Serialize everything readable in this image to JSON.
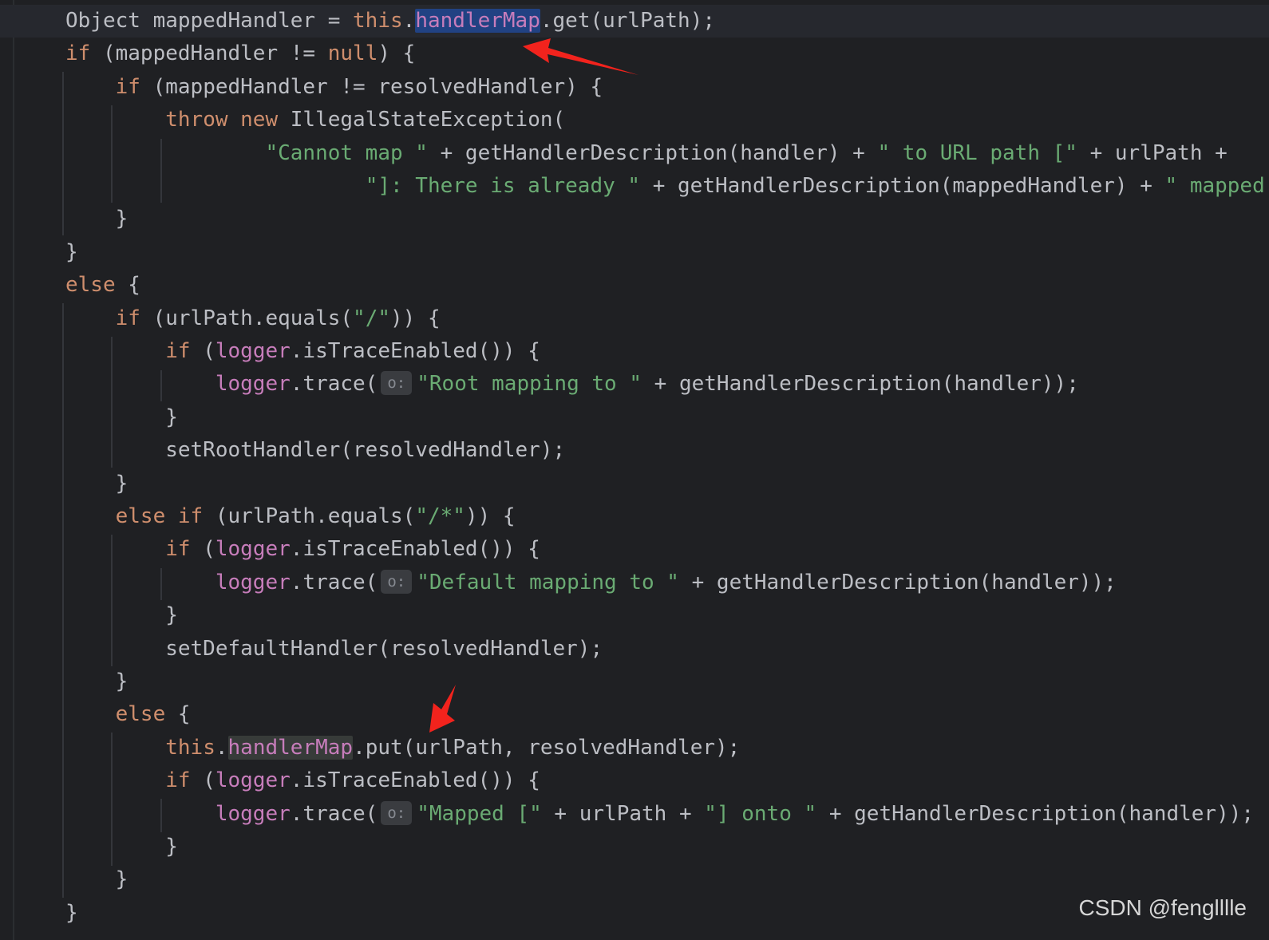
{
  "colors": {
    "background": "#1f2023",
    "default_text": "#bcbec4",
    "keyword": "#cf8e6d",
    "string": "#6aab73",
    "field": "#c77dbb",
    "hint_text": "#868a91",
    "annotation_arrow": "#f2231d"
  },
  "code": {
    "lines": [
      {
        "tokens": [
          {
            "text": "Object mappedHandler = ",
            "c": "d"
          },
          {
            "text": "this",
            "c": "k"
          },
          {
            "text": ".",
            "c": "d"
          },
          {
            "text": "handlerMap",
            "c": "f",
            "hl": "sel"
          },
          {
            "text": ".get(urlPath);",
            "c": "d"
          }
        ]
      },
      {
        "tokens": [
          {
            "text": "if",
            "c": "k"
          },
          {
            "text": " (mappedHandler != ",
            "c": "d"
          },
          {
            "text": "null",
            "c": "k"
          },
          {
            "text": ") {",
            "c": "d"
          }
        ]
      },
      {
        "tokens": [
          {
            "text": "    ",
            "c": "d"
          },
          {
            "text": "if",
            "c": "k"
          },
          {
            "text": " (mappedHandler != resolvedHandler) {",
            "c": "d"
          }
        ]
      },
      {
        "tokens": [
          {
            "text": "        ",
            "c": "d"
          },
          {
            "text": "throw new",
            "c": "k"
          },
          {
            "text": " IllegalStateException(",
            "c": "d"
          }
        ]
      },
      {
        "tokens": [
          {
            "text": "                ",
            "c": "d"
          },
          {
            "text": "\"Cannot map \"",
            "c": "s"
          },
          {
            "text": " + getHandlerDescription(handler) + ",
            "c": "d"
          },
          {
            "text": "\" to URL path [\"",
            "c": "s"
          },
          {
            "text": " + urlPath +",
            "c": "d"
          }
        ]
      },
      {
        "tokens": [
          {
            "text": "                        ",
            "c": "d"
          },
          {
            "text": "\"]: There is already \"",
            "c": "s"
          },
          {
            "text": " + getHandlerDescription(mappedHandler) + ",
            "c": "d"
          },
          {
            "text": "\" mapped.",
            "c": "s"
          }
        ]
      },
      {
        "tokens": [
          {
            "text": "    }",
            "c": "d"
          }
        ]
      },
      {
        "tokens": [
          {
            "text": "}",
            "c": "d"
          }
        ]
      },
      {
        "tokens": [
          {
            "text": "else",
            "c": "k"
          },
          {
            "text": " {",
            "c": "d"
          }
        ]
      },
      {
        "tokens": [
          {
            "text": "    ",
            "c": "d"
          },
          {
            "text": "if",
            "c": "k"
          },
          {
            "text": " (urlPath.equals(",
            "c": "d"
          },
          {
            "text": "\"/\"",
            "c": "s"
          },
          {
            "text": ")) {",
            "c": "d"
          }
        ]
      },
      {
        "tokens": [
          {
            "text": "        ",
            "c": "d"
          },
          {
            "text": "if",
            "c": "k"
          },
          {
            "text": " (",
            "c": "d"
          },
          {
            "text": "logger",
            "c": "f"
          },
          {
            "text": ".isTraceEnabled()) {",
            "c": "d"
          }
        ]
      },
      {
        "tokens": [
          {
            "text": "            ",
            "c": "d"
          },
          {
            "text": "logger",
            "c": "f"
          },
          {
            "text": ".trace(",
            "c": "d"
          },
          {
            "text": "o:",
            "c": "hint"
          },
          {
            "text": "\"Root mapping to \"",
            "c": "s"
          },
          {
            "text": " + getHandlerDescription(handler));",
            "c": "d"
          }
        ]
      },
      {
        "tokens": [
          {
            "text": "        }",
            "c": "d"
          }
        ]
      },
      {
        "tokens": [
          {
            "text": "        setRootHandler(resolvedHandler);",
            "c": "d"
          }
        ]
      },
      {
        "tokens": [
          {
            "text": "    }",
            "c": "d"
          }
        ]
      },
      {
        "tokens": [
          {
            "text": "    ",
            "c": "d"
          },
          {
            "text": "else if",
            "c": "k"
          },
          {
            "text": " (urlPath.equals(",
            "c": "d"
          },
          {
            "text": "\"/*\"",
            "c": "s"
          },
          {
            "text": ")) {",
            "c": "d"
          }
        ]
      },
      {
        "tokens": [
          {
            "text": "        ",
            "c": "d"
          },
          {
            "text": "if",
            "c": "k"
          },
          {
            "text": " (",
            "c": "d"
          },
          {
            "text": "logger",
            "c": "f"
          },
          {
            "text": ".isTraceEnabled()) {",
            "c": "d"
          }
        ]
      },
      {
        "tokens": [
          {
            "text": "            ",
            "c": "d"
          },
          {
            "text": "logger",
            "c": "f"
          },
          {
            "text": ".trace(",
            "c": "d"
          },
          {
            "text": "o:",
            "c": "hint"
          },
          {
            "text": "\"Default mapping to \"",
            "c": "s"
          },
          {
            "text": " + getHandlerDescription(handler));",
            "c": "d"
          }
        ]
      },
      {
        "tokens": [
          {
            "text": "        }",
            "c": "d"
          }
        ]
      },
      {
        "tokens": [
          {
            "text": "        setDefaultHandler(resolvedHandler);",
            "c": "d"
          }
        ]
      },
      {
        "tokens": [
          {
            "text": "    }",
            "c": "d"
          }
        ]
      },
      {
        "tokens": [
          {
            "text": "    ",
            "c": "d"
          },
          {
            "text": "else",
            "c": "k"
          },
          {
            "text": " {",
            "c": "d"
          }
        ]
      },
      {
        "tokens": [
          {
            "text": "        ",
            "c": "d"
          },
          {
            "text": "this",
            "c": "k"
          },
          {
            "text": ".",
            "c": "d"
          },
          {
            "text": "handlerMap",
            "c": "f",
            "hl": "occ"
          },
          {
            "text": ".put(urlPath, resolvedHandler);",
            "c": "d"
          }
        ]
      },
      {
        "tokens": [
          {
            "text": "        ",
            "c": "d"
          },
          {
            "text": "if",
            "c": "k"
          },
          {
            "text": " (",
            "c": "d"
          },
          {
            "text": "logger",
            "c": "f"
          },
          {
            "text": ".isTraceEnabled()) {",
            "c": "d"
          }
        ]
      },
      {
        "tokens": [
          {
            "text": "            ",
            "c": "d"
          },
          {
            "text": "logger",
            "c": "f"
          },
          {
            "text": ".trace(",
            "c": "d"
          },
          {
            "text": "o:",
            "c": "hint"
          },
          {
            "text": "\"Mapped [\"",
            "c": "s"
          },
          {
            "text": " + urlPath + ",
            "c": "d"
          },
          {
            "text": "\"] onto \"",
            "c": "s"
          },
          {
            "text": " + getHandlerDescription(handler));",
            "c": "d"
          }
        ]
      },
      {
        "tokens": [
          {
            "text": "        }",
            "c": "d"
          }
        ]
      },
      {
        "tokens": [
          {
            "text": "    }",
            "c": "d"
          }
        ]
      },
      {
        "tokens": [
          {
            "text": "}",
            "c": "d"
          }
        ]
      }
    ]
  },
  "watermark": {
    "text": "CSDN @fenglllle"
  }
}
